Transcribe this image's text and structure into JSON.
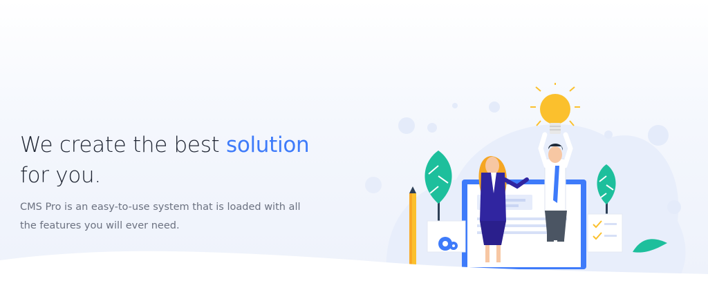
{
  "hero": {
    "headline_prefix": "We create the best ",
    "headline_highlight": "solution",
    "headline_suffix": "for you.",
    "subtitle_line1": "CMS Pro is an easy-to-use system that is loaded with all",
    "subtitle_line2": "the features you will ever need.",
    "accent_color": "#3e7bfa"
  },
  "illustration": {
    "icons": [
      "lightbulb-icon",
      "gear-icon",
      "checkmark-icon",
      "tree-icon",
      "pencil-icon"
    ]
  }
}
